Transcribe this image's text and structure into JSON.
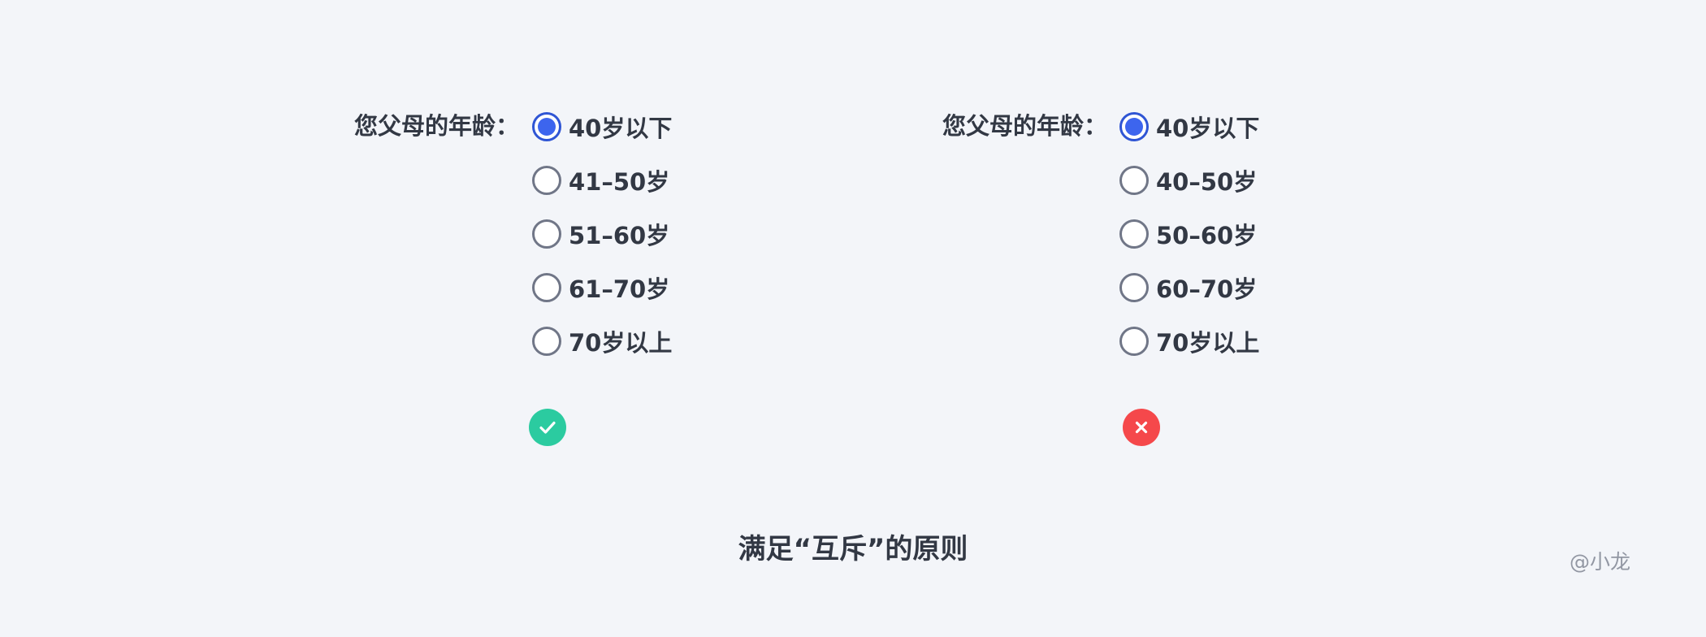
{
  "question_label": "您父母的年龄：",
  "left_options": [
    {
      "label": "40岁以下",
      "checked": true
    },
    {
      "label": "41–50岁",
      "checked": false
    },
    {
      "label": "51–60岁",
      "checked": false
    },
    {
      "label": "61–70岁",
      "checked": false
    },
    {
      "label": "70岁以上",
      "checked": false
    }
  ],
  "right_options": [
    {
      "label": "40岁以下",
      "checked": true
    },
    {
      "label": "40–50岁",
      "checked": false
    },
    {
      "label": "50–60岁",
      "checked": false
    },
    {
      "label": "60–70岁",
      "checked": false
    },
    {
      "label": "70岁以上",
      "checked": false
    }
  ],
  "left_verdict": {
    "icon": "check-icon",
    "color": "#2bcba0"
  },
  "right_verdict": {
    "icon": "close-icon",
    "color": "#f5484b"
  },
  "caption": "满足“互斥”的原则",
  "watermark": "@小龙",
  "colors": {
    "radio_selected": "#3d65ee",
    "radio_border": "#707687",
    "text": "#323844",
    "background": "#f3f5f9"
  }
}
